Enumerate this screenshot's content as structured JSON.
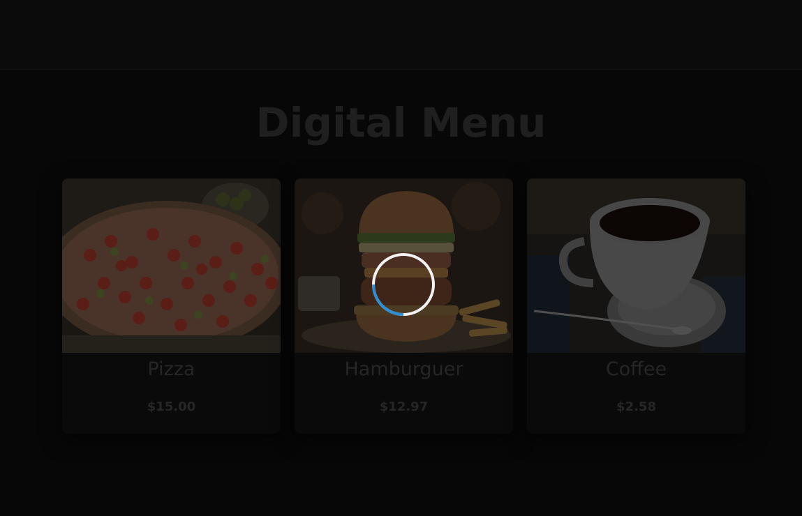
{
  "page": {
    "title": "Digital Menu"
  },
  "menu": {
    "items": [
      {
        "name": "Pizza",
        "price": "$15.00",
        "image_icon": "pizza-image"
      },
      {
        "name": "Hamburguer",
        "price": "$12.97",
        "image_icon": "hamburger-image"
      },
      {
        "name": "Coffee",
        "price": "$2.58",
        "image_icon": "coffee-image"
      }
    ]
  },
  "loading": {
    "icon": "loading-spinner-icon",
    "accent_color": "#2a8fd6",
    "ring_color": "#f2f2f2"
  },
  "colors": {
    "background": "#070707",
    "text_dim": "#262626"
  }
}
